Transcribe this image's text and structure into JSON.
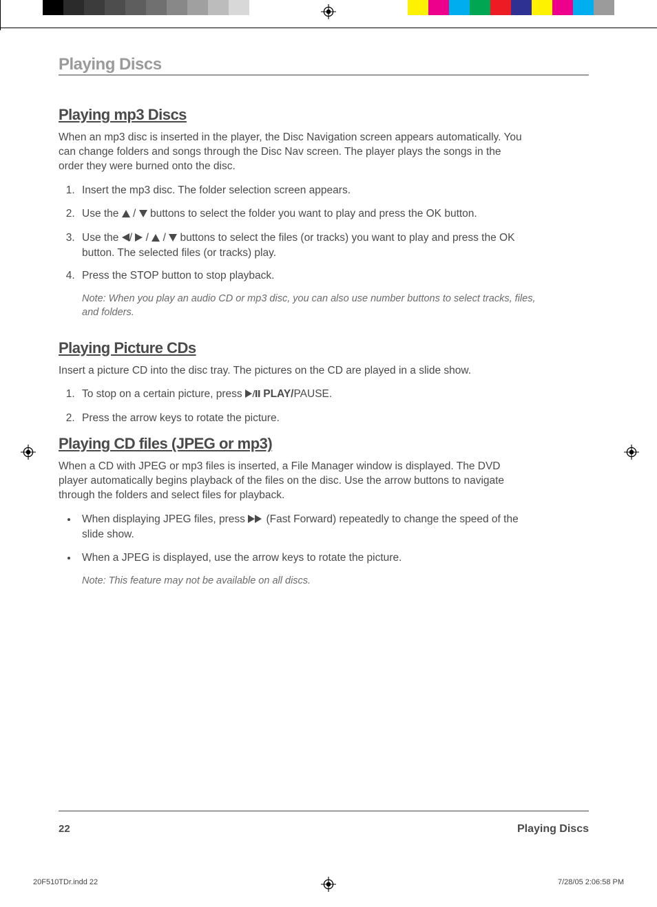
{
  "colorBar": {
    "gray": [
      "#000000",
      "#2b2b2b",
      "#3c3c3c",
      "#4d4d4d",
      "#5e5e5e",
      "#707070",
      "#888888",
      "#a0a0a0",
      "#bcbcbc",
      "#d8d8d8",
      "#ffffff"
    ],
    "color": [
      "#fff200",
      "#ec008c",
      "#00aeef",
      "#00a651",
      "#ed1c24",
      "#2e3192",
      "#fff200",
      "#ec008c",
      "#00aeef",
      "#9b9b9b"
    ]
  },
  "chapterTitle": "Playing Discs",
  "section1": {
    "title": "Playing mp3 Discs",
    "intro": "When an mp3 disc is inserted in the player, the Disc Navigation screen appears automatically. You can change folders and songs through the Disc Nav screen. The player plays the songs in the order they were burned onto the disc.",
    "step1": "Insert the mp3 disc. The folder selection screen appears.",
    "step2a": "Use the ",
    "step2b": " buttons to select the folder you want to play and press the OK button.",
    "step3a": "Use the ",
    "step3b": " buttons to select the files (or tracks) you want to play and press the OK button. The selected files (or tracks) play.",
    "step4": "Press the STOP button to stop playback.",
    "note": "Note: When you play an audio CD or mp3 disc, you can also use number buttons to select tracks, files, and folders."
  },
  "section2": {
    "title": "Playing Picture CDs",
    "intro": "Insert a picture CD into the disc tray. The pictures on the CD are played in a slide show.",
    "step1a": "To stop on a certain picture, press ",
    "step1b": " PLAY/",
    "step1c": "PAUSE.",
    "step2": "Press the arrow keys to rotate the picture."
  },
  "section3": {
    "title": "Playing CD files (JPEG or mp3)",
    "intro": "When a CD with JPEG or mp3 files is inserted, a File Manager window is displayed. The DVD player automatically begins playback of the files on the disc. Use the arrow buttons to navigate through the folders and select files for playback.",
    "bullet1a": "When displaying JPEG files, press  ",
    "bullet1b": " (Fast Forward)  repeatedly to change the speed of the slide show.",
    "bullet2": "When a JPEG is displayed, use the arrow keys to rotate the picture.",
    "note": "Note: This feature may not be available on all discs."
  },
  "footer": {
    "pageNumber": "22",
    "label": "Playing Discs"
  },
  "slug": {
    "file": "20F510TDr.indd   22",
    "datetime": "7/28/05   2:06:58 PM"
  },
  "glyphs": {
    "sep": " / "
  }
}
